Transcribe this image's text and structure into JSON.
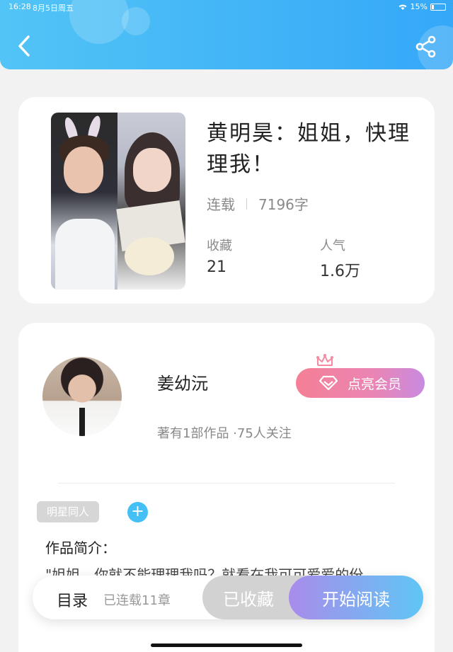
{
  "status_bar": {
    "time": "16:28",
    "date": "8月5日周五",
    "battery": "15%"
  },
  "book": {
    "title": "黄明昊：姐姐，快理理我！",
    "status": "连载",
    "word_count": "7196字",
    "stats": [
      {
        "label": "收藏",
        "value": "21"
      },
      {
        "label": "人气",
        "value": "1.6万"
      }
    ]
  },
  "author": {
    "name": "姜幼沅",
    "info": "著有1部作品 ·75人关注",
    "vip_label": "点亮会员"
  },
  "tags": [
    "明星同人"
  ],
  "intro": {
    "label": "作品简介：",
    "text": "\"姐姐，你就不能理理我吗？就看在我可可爱爱的份"
  },
  "bottom_bar": {
    "toc": "目录",
    "chapters": "已连载11章",
    "collected": "已收藏",
    "read": "开始阅读"
  }
}
